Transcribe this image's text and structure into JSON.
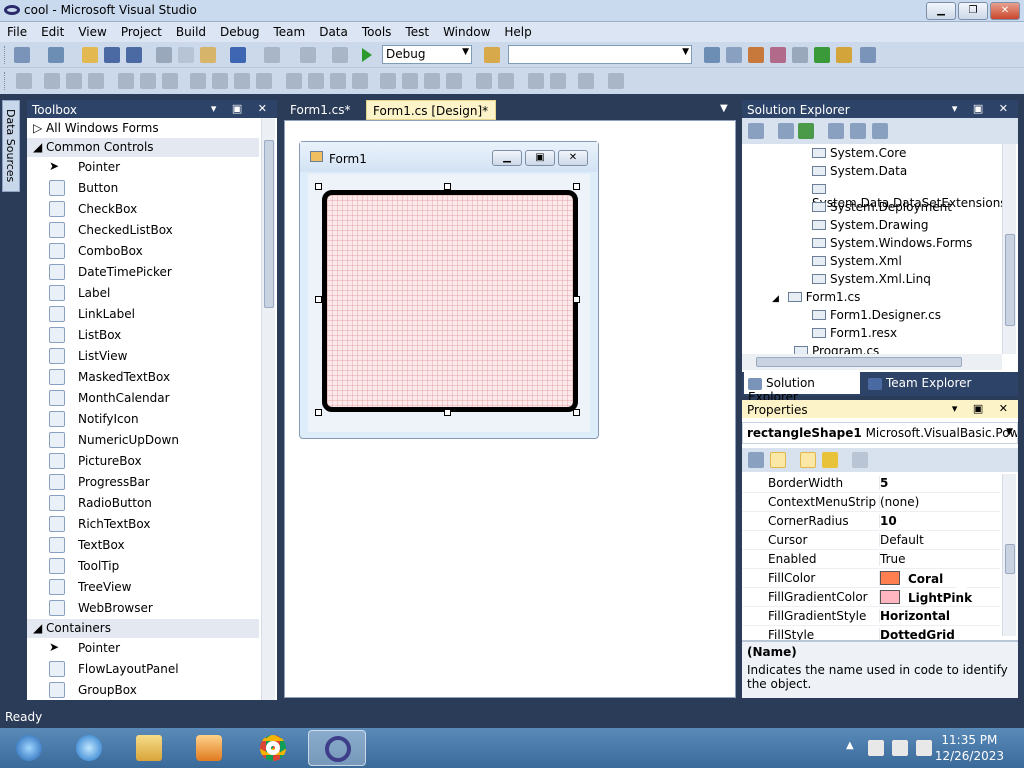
{
  "window": {
    "title": "cool - Microsoft Visual Studio"
  },
  "menu": [
    "File",
    "Edit",
    "View",
    "Project",
    "Build",
    "Debug",
    "Team",
    "Data",
    "Tools",
    "Test",
    "Window",
    "Help"
  ],
  "toolbar": {
    "config": "Debug",
    "platform": ""
  },
  "side_tab": "Data Sources",
  "toolbox": {
    "title": "Toolbox",
    "groups": [
      {
        "label": "All Windows Forms"
      },
      {
        "label": "Common Controls"
      },
      {
        "label": "Containers"
      }
    ],
    "items": [
      "Pointer",
      "Button",
      "CheckBox",
      "CheckedListBox",
      "ComboBox",
      "DateTimePicker",
      "Label",
      "LinkLabel",
      "ListBox",
      "ListView",
      "MaskedTextBox",
      "MonthCalendar",
      "NotifyIcon",
      "NumericUpDown",
      "PictureBox",
      "ProgressBar",
      "RadioButton",
      "RichTextBox",
      "TextBox",
      "ToolTip",
      "TreeView",
      "WebBrowser"
    ],
    "container_items": [
      "Pointer",
      "FlowLayoutPanel",
      "GroupBox"
    ]
  },
  "editor": {
    "tabs": [
      "Form1.cs*",
      "Form1.cs [Design]*"
    ],
    "form_title": "Form1"
  },
  "solution_explorer": {
    "title": "Solution Explorer",
    "nodes": [
      "System.Core",
      "System.Data",
      "System.Data.DataSetExtensions",
      "System.Deployment",
      "System.Drawing",
      "System.Windows.Forms",
      "System.Xml",
      "System.Xml.Linq",
      "Form1.cs",
      "Form1.Designer.cs",
      "Form1.resx",
      "Program.cs"
    ],
    "tabs": [
      "Solution Explorer",
      "Team Explorer"
    ]
  },
  "properties": {
    "title": "Properties",
    "object_name": "rectangleShape1",
    "object_type": "Microsoft.VisualBasic.PowerP",
    "rows": [
      {
        "name": "BorderWidth",
        "value": "5"
      },
      {
        "name": "ContextMenuStrip",
        "value": "(none)"
      },
      {
        "name": "CornerRadius",
        "value": "10"
      },
      {
        "name": "Cursor",
        "value": "Default"
      },
      {
        "name": "Enabled",
        "value": "True"
      },
      {
        "name": "FillColor",
        "value": "Coral"
      },
      {
        "name": "FillGradientColor",
        "value": "LightPink"
      },
      {
        "name": "FillGradientStyle",
        "value": "Horizontal"
      },
      {
        "name": "FillStyle",
        "value": "DottedGrid"
      }
    ],
    "desc_title": "(Name)",
    "desc_text": "Indicates the name used in code to identify the object."
  },
  "colors": {
    "coral": "#FF7F50",
    "lightpink": "#FFB6C1"
  },
  "status": "Ready",
  "clock": {
    "time": "11:35 PM",
    "date": "12/26/2023"
  }
}
